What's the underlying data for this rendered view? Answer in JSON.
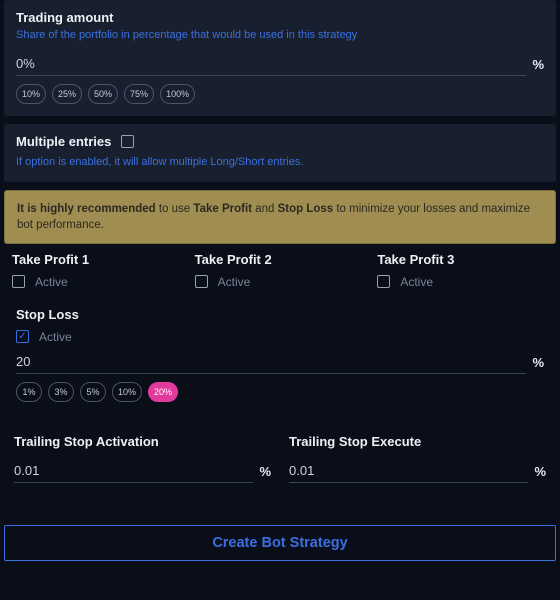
{
  "tradingAmount": {
    "title": "Trading amount",
    "help": "Share of the portfolio in percentage that would be used in this strategy",
    "value": "0%",
    "suffix": "%",
    "chips": [
      "10%",
      "25%",
      "50%",
      "75%",
      "100%"
    ]
  },
  "multipleEntries": {
    "title": "Multiple entries",
    "help": "If option is enabled, it will allow multiple Long/Short entries."
  },
  "banner": {
    "pre": "It is highly recommended ",
    "mid1": "to use ",
    "tp": "Take Profit",
    "and": " and ",
    "sl": "Stop Loss",
    "post": " to minimize your losses and maximize bot performance."
  },
  "tp": {
    "1": {
      "title": "Take Profit 1",
      "active": "Active"
    },
    "2": {
      "title": "Take Profit 2",
      "active": "Active"
    },
    "3": {
      "title": "Take Profit 3",
      "active": "Active"
    }
  },
  "stopLoss": {
    "title": "Stop Loss",
    "active": "Active",
    "value": "20",
    "suffix": "%",
    "chips": [
      "1%",
      "3%",
      "5%",
      "10%",
      "20%"
    ],
    "selected": 4
  },
  "trailing": {
    "activation": {
      "title": "Trailing Stop Activation",
      "value": "0.01",
      "suffix": "%"
    },
    "execute": {
      "title": "Trailing Stop Execute",
      "value": "0.01",
      "suffix": "%"
    }
  },
  "actions": {
    "create": "Create Bot Strategy"
  }
}
